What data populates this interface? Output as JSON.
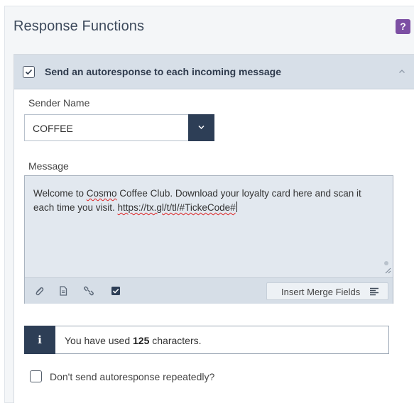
{
  "panel": {
    "title": "Response Functions",
    "help_label": "?"
  },
  "autoresponse": {
    "enabled": true,
    "label": "Send an autoresponse to each incoming message",
    "expanded": true
  },
  "sender": {
    "label": "Sender Name",
    "value": "COFFEE"
  },
  "message": {
    "label": "Message",
    "text_before": "Welcome to ",
    "text_squiggle_1": "Cosmo",
    "text_mid": " Coffee Club. Download your loyalty card here and scan it each time you visit. ",
    "text_squiggle_2": "https://tx.gl/t/tl/#TickeCode#",
    "toolbar": {
      "icons": [
        "paperclip-icon",
        "document-icon",
        "link-icon",
        "checkbox-icon"
      ],
      "merge_label": "Insert Merge Fields"
    }
  },
  "info": {
    "badge": "i",
    "prefix": "You have used ",
    "count": "125",
    "suffix": " characters."
  },
  "repeat": {
    "checked": false,
    "label": "Don't send autoresponse repeatedly?"
  },
  "colors": {
    "accent_dark": "#2d3e56",
    "help_purple": "#7c4fa3",
    "header_bg": "#d7dfe8"
  }
}
